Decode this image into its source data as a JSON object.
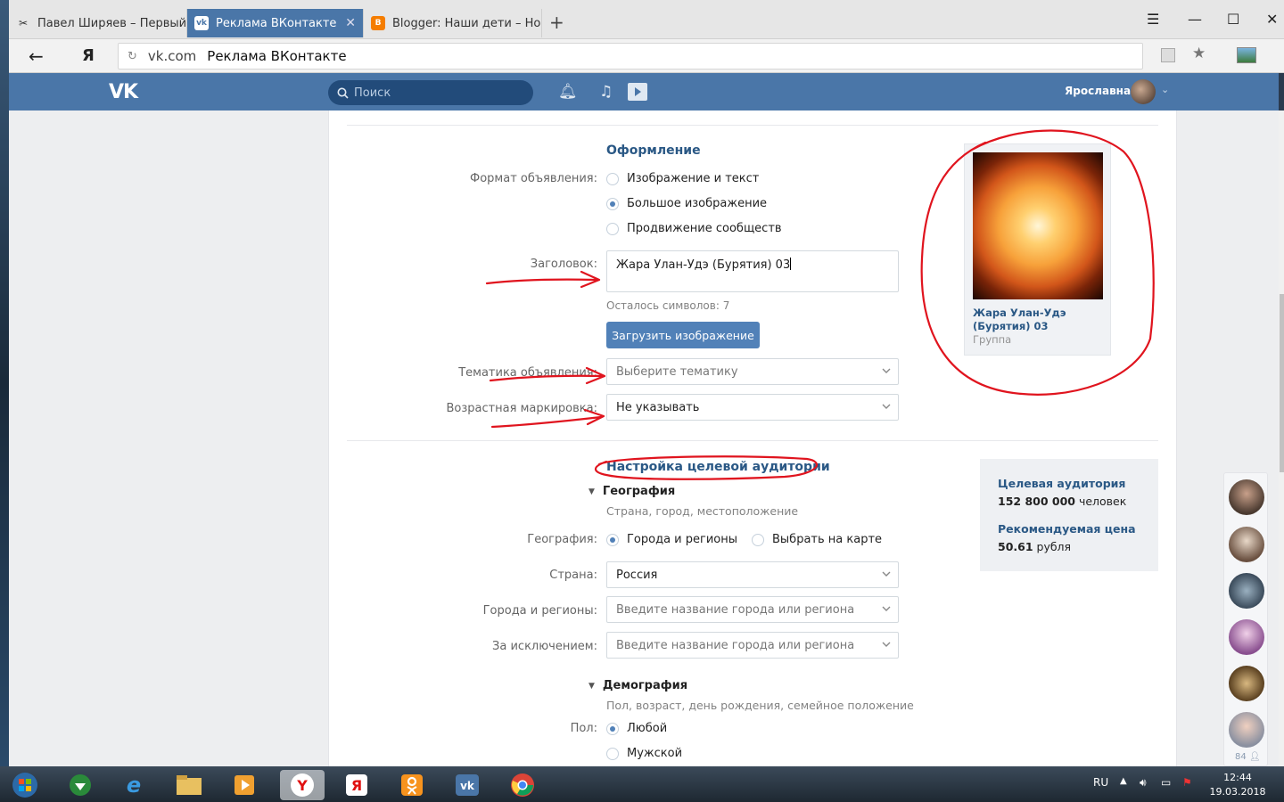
{
  "browser": {
    "tabs": [
      {
        "label": "Павел Ширяев – Первый ур",
        "active": false
      },
      {
        "label": "Реклама ВКонтакте",
        "active": true
      },
      {
        "label": "Blogger: Наши дети – Ново",
        "active": false
      }
    ],
    "new_tab": "+",
    "address": {
      "host": "vk.com",
      "title": "Реклама ВКонтакте"
    }
  },
  "vk": {
    "logo": "VK",
    "search_placeholder": "Поиск",
    "user_name": "Ярославна"
  },
  "design": {
    "title": "Оформление",
    "format_label": "Формат объявления:",
    "format_options": [
      {
        "label": "Изображение и текст",
        "selected": false
      },
      {
        "label": "Большое изображение",
        "selected": true
      },
      {
        "label": "Продвижение сообществ",
        "selected": false
      }
    ],
    "headline_label": "Заголовок:",
    "headline_value": "Жара Улан-Удэ (Бурятия) 03",
    "chars_left": "Осталось символов: 7",
    "upload_button": "Загрузить изображение",
    "topic_label": "Тематика объявления:",
    "topic_placeholder": "Выберите тематику",
    "age_label": "Возрастная маркировка:",
    "age_value": "Не указывать"
  },
  "preview": {
    "title": "Жара Улан-Удэ (Бурятия) 03",
    "subtitle": "Группа"
  },
  "targeting": {
    "title": "Настройка целевой аудитории",
    "geo_head": "География",
    "geo_desc": "Страна, город, местоположение",
    "geo_label": "География:",
    "geo_options": [
      {
        "label": "Города и регионы",
        "selected": true
      },
      {
        "label": "Выбрать на карте",
        "selected": false
      }
    ],
    "country_label": "Страна:",
    "country_value": "Россия",
    "cities_label": "Города и регионы:",
    "cities_placeholder": "Введите название города или региона",
    "except_label": "За исключением:",
    "except_placeholder": "Введите название города или региона",
    "demo_head": "Демография",
    "demo_desc": "Пол, возраст, день рождения, семейное положение",
    "sex_label": "Пол:",
    "sex_options": [
      {
        "label": "Любой",
        "selected": true
      },
      {
        "label": "Мужской",
        "selected": false
      }
    ]
  },
  "audience": {
    "target_label": "Целевая аудитория",
    "target_number": "152 800 000",
    "target_unit": " человек",
    "price_label": "Рекомендуемая цена",
    "price_number": "50.61",
    "price_unit": " рубля"
  },
  "friends": {
    "count": "84"
  },
  "taskbar": {
    "lang": "RU",
    "time": "12:44",
    "date": "19.03.2018"
  },
  "colors": {
    "vk_blue": "#4a76a8",
    "link_blue": "#2a5885",
    "button_blue": "#5181b8",
    "annotation_red": "#e0141e"
  }
}
